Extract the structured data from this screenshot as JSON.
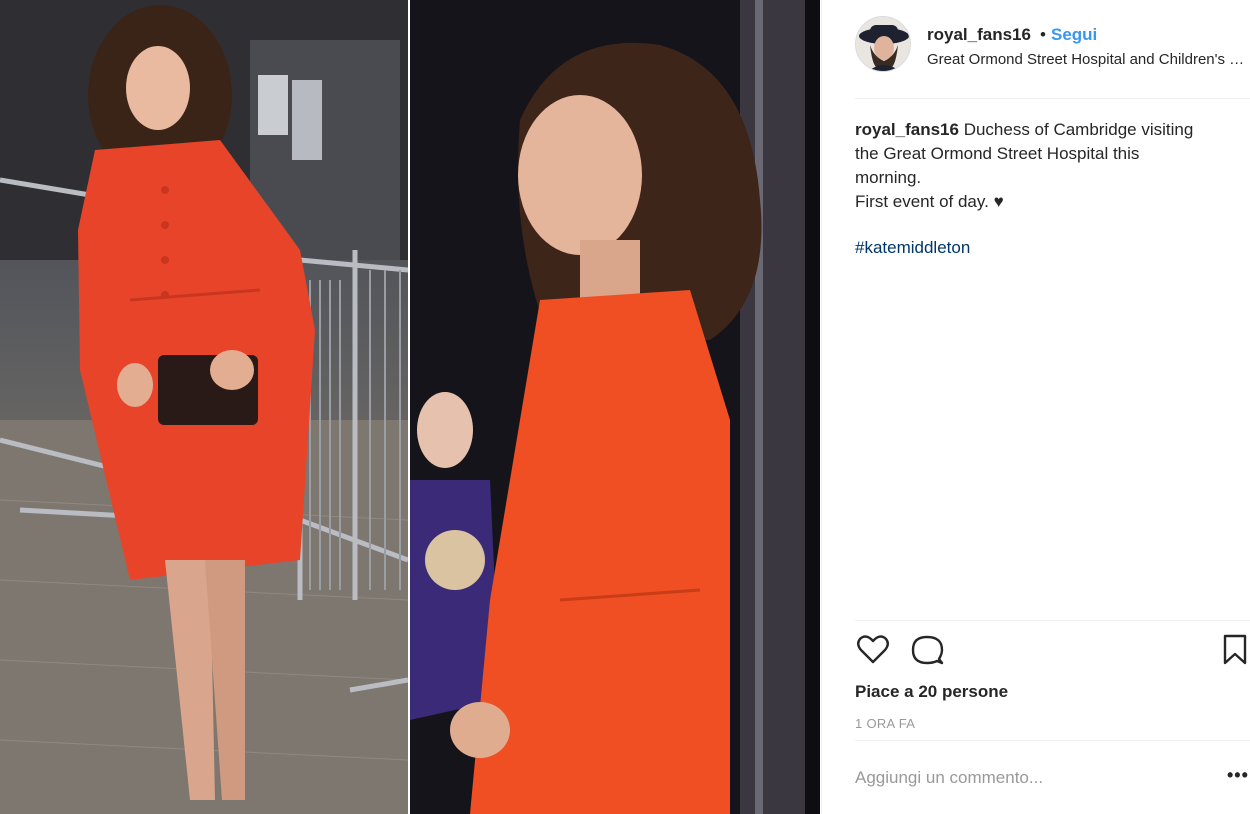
{
  "post": {
    "username": "royal_fans16",
    "separator": "•",
    "follow_label": "Segui",
    "location": "Great Ormond Street Hospital and Children's Charity",
    "caption": {
      "username": "royal_fans16",
      "line1": "Duchess of Cambridge visiting",
      "line2": "the Great Ormond Street Hospital this",
      "line3": "morning.",
      "line4": "First event of day. ♥"
    },
    "hashtag": "#katemiddleton",
    "likes": "Piace a 20 persone",
    "time": "1 ORA FA",
    "comment_placeholder": "Aggiungi un commento...",
    "more_label": "•••"
  },
  "icons": {
    "like": "heart-icon",
    "comment": "speech-bubble-icon",
    "save": "bookmark-icon",
    "more": "more-options-icon"
  },
  "colors": {
    "accent": "#3897f0",
    "hashtag": "#003569",
    "muted": "#999999",
    "coat": "#e8442a"
  }
}
